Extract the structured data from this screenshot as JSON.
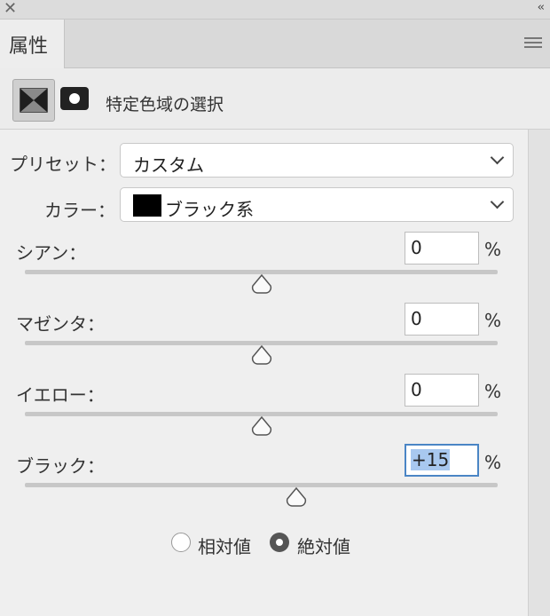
{
  "window": {
    "close_icon": "✕",
    "collapse_icon": "‹‹"
  },
  "tab": {
    "label": "属性"
  },
  "header": {
    "title": "特定色域の選択"
  },
  "preset": {
    "label": "プリセット：",
    "value": "カスタム"
  },
  "color": {
    "label": "カラー：",
    "value": "ブラック系",
    "swatch_color": "#000000"
  },
  "sliders": [
    {
      "label": "シアン：",
      "value": "0",
      "unit": "%",
      "level": 0
    },
    {
      "label": "マゼンタ：",
      "value": "0",
      "unit": "%",
      "level": 0
    },
    {
      "label": "イエロー：",
      "value": "0",
      "unit": "%",
      "level": 0
    },
    {
      "label": "ブラック：",
      "value": "+15",
      "unit": "%",
      "level": 15
    }
  ],
  "method": {
    "options": [
      {
        "label": "相対値",
        "selected": false
      },
      {
        "label": "絶対値",
        "selected": true
      }
    ]
  },
  "colors": {
    "focus": "#4a85c5",
    "selection": "#a8c8ef"
  }
}
